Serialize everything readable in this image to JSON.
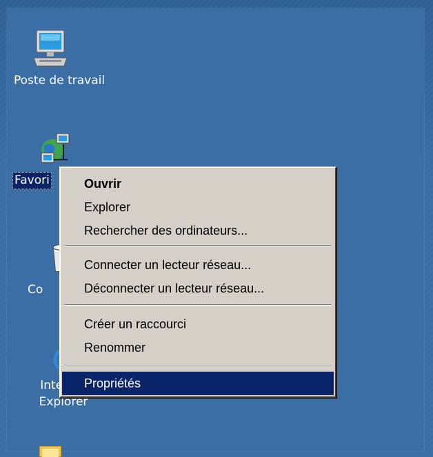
{
  "desktop": {
    "icons": [
      {
        "label": "Poste de travail",
        "icon": "computer-icon"
      },
      {
        "label": "Favori",
        "icon": "network-places-icon",
        "selected": true
      },
      {
        "label": "Co",
        "icon": "recycle-bin-icon"
      },
      {
        "label": "Internet Explorer",
        "label_line1": "Internet",
        "label_line2": "Explorer",
        "icon": "internet-explorer-icon"
      },
      {
        "label": "",
        "icon": "folder-icon"
      }
    ]
  },
  "context_menu": {
    "items": [
      {
        "label": "Ouvrir",
        "default": true
      },
      {
        "label": "Explorer"
      },
      {
        "label": "Rechercher des ordinateurs..."
      },
      {
        "label": "Connecter un lecteur réseau..."
      },
      {
        "label": "Déconnecter un lecteur réseau..."
      },
      {
        "label": "Créer un raccourci"
      },
      {
        "label": "Renommer"
      },
      {
        "label": "Propriétés",
        "highlighted": true
      }
    ]
  },
  "colors": {
    "desktop": "#3a6ea5",
    "menu_bg": "#d4d0c8",
    "selection": "#0a246a"
  }
}
